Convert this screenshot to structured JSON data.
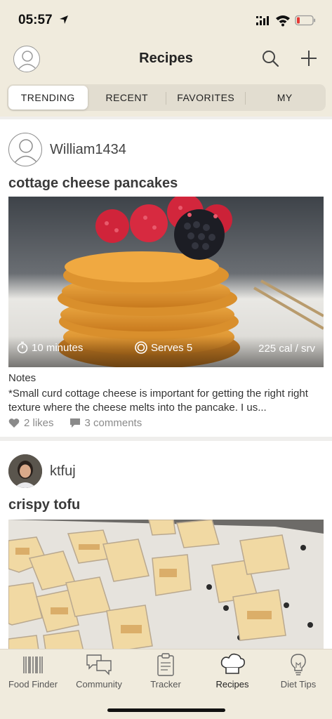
{
  "status": {
    "time": "05:57"
  },
  "header": {
    "title": "Recipes"
  },
  "tabs": [
    {
      "label": "TRENDING",
      "active": true
    },
    {
      "label": "RECENT",
      "active": false
    },
    {
      "label": "FAVORITES",
      "active": false
    },
    {
      "label": "MY",
      "active": false
    }
  ],
  "posts": [
    {
      "user": "William1434",
      "title": "cottage cheese pancakes",
      "time": "10 minutes",
      "serves": "Serves 5",
      "calories": "225 cal / srv",
      "notes_label": "Notes",
      "notes": "*Small curd cottage cheese is important for getting the right right texture where the cheese melts into the pancake. I us...",
      "likes": "2 likes",
      "comments": "3 comments"
    },
    {
      "user": "ktfuj",
      "title": "crispy tofu"
    }
  ],
  "nav": [
    {
      "label": "Food Finder",
      "icon": "barcode-icon"
    },
    {
      "label": "Community",
      "icon": "chat-bubbles-icon"
    },
    {
      "label": "Tracker",
      "icon": "clipboard-icon"
    },
    {
      "label": "Recipes",
      "icon": "chef-hat-icon",
      "active": true
    },
    {
      "label": "Diet Tips",
      "icon": "lightbulb-icon"
    }
  ],
  "colors": {
    "chrome": "#f0ebdd",
    "feed_bg": "#efeeec",
    "battery_low": "#e53935"
  }
}
